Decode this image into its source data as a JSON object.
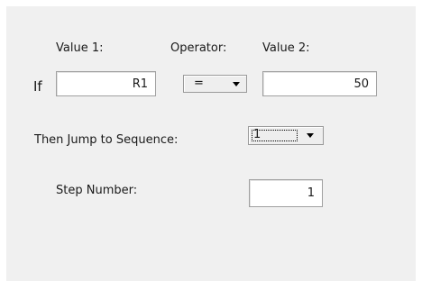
{
  "condition": {
    "if_label": "If",
    "value1": {
      "label": "Value 1:",
      "value": "R1"
    },
    "operator": {
      "label": "Operator:",
      "selected": "="
    },
    "value2": {
      "label": "Value 2:",
      "value": "50"
    }
  },
  "jump": {
    "label": "Then Jump to Sequence:",
    "selected": "1"
  },
  "step": {
    "label": "Step Number:",
    "value": "1"
  },
  "icons": {
    "dropdown": "chevron-down-icon"
  }
}
